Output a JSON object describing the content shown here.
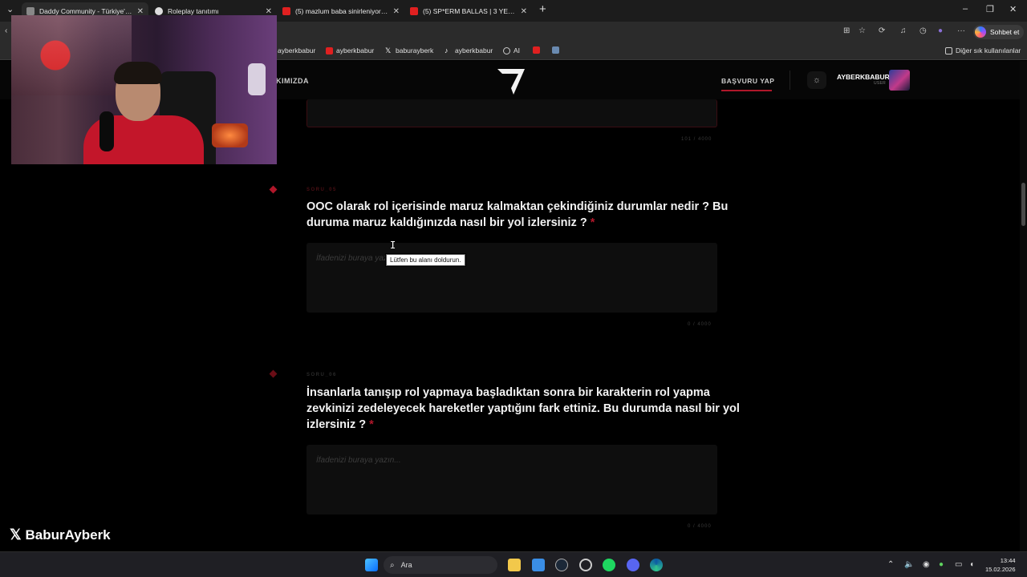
{
  "browser": {
    "tabs": [
      {
        "title": "Daddy Community - Türkiye'nin En",
        "active": true
      },
      {
        "title": "Roleplay tanıtımı",
        "active": false
      },
      {
        "title": "(5) mazlum baba sinirleniyor ama",
        "active": false
      },
      {
        "title": "(5) SP*ERM BALLAS | 3 YEARS OLD",
        "active": false
      }
    ],
    "new_tab_symbol": "+",
    "chat_button": "Sohbet et",
    "bookmarks": [
      "ayberkbabur",
      "ayberkbabur",
      "baburayberk",
      "ayberkbabur",
      "AI"
    ],
    "other_favorites": "Diğer sık kullanılanlar"
  },
  "site": {
    "nav_left": "KIMIZDA",
    "apply_link": "BAŞVURU YAP",
    "user": {
      "name": "AYBERKBABUR",
      "role": "USER"
    }
  },
  "form": {
    "prev_counter": "101 / 4000",
    "questions": [
      {
        "code": "SORU_05",
        "title": "OOC olarak rol içerisinde maruz kalmaktan çekindiğiniz durumlar nedir ? Bu duruma maruz kaldığınızda nasıl bir yol izlersiniz ?",
        "required_mark": "*",
        "placeholder": "İfadenizi buraya yazın...",
        "counter": "0 / 4000"
      },
      {
        "code": "SORU_06",
        "title": "İnsanlarla tanışıp rol yapmaya başladıktan sonra bir karakterin rol yapma zevkinizi zedeleyecek hareketler yaptığını fark ettiniz. Bu durumda nasıl bir yol izlersiniz ?",
        "required_mark": "*",
        "placeholder": "İfadenizi buraya yazın...",
        "counter": "0 / 4000"
      }
    ],
    "validation_tooltip": "Lütfen bu alanı doldurun."
  },
  "overlay": {
    "handle": "BaburAyberk"
  },
  "taskbar": {
    "search_label": "Ara",
    "time": "13:44",
    "date": "15.02.2026"
  },
  "colors": {
    "accent": "#b0172a",
    "background": "#000000"
  }
}
